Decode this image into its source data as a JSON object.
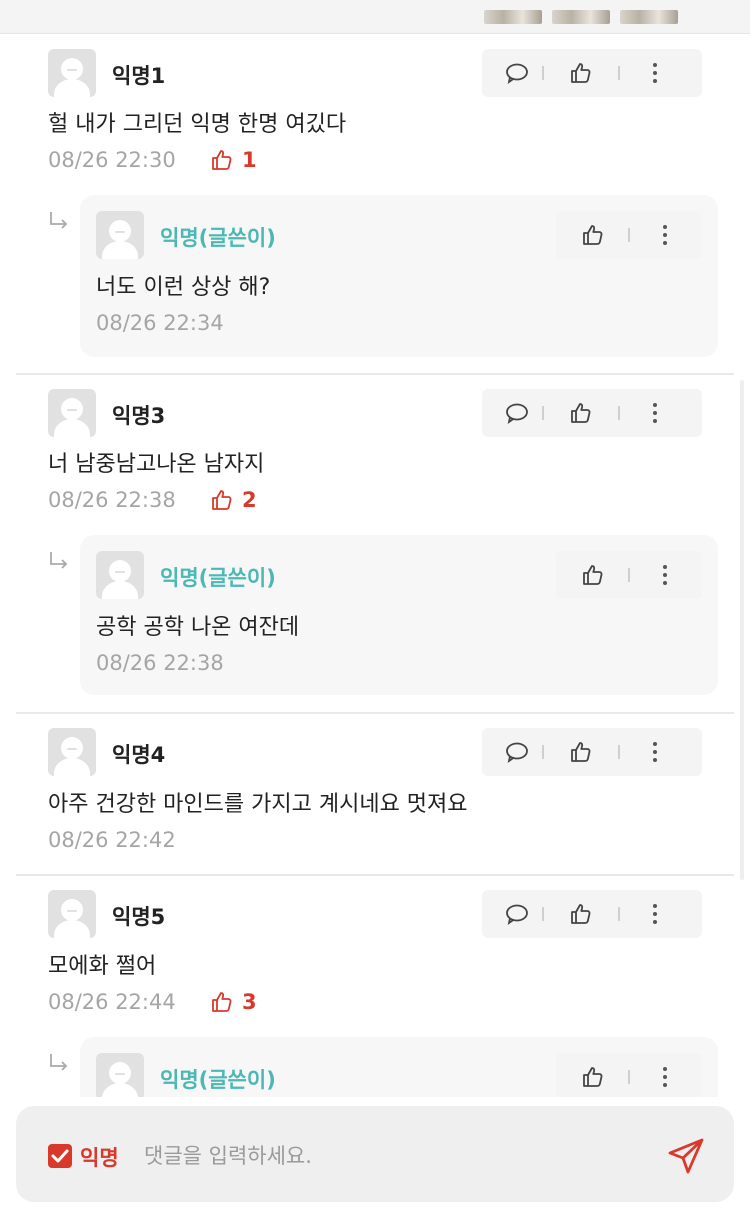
{
  "colors": {
    "accent": "#d8392b",
    "writer": "#4bb8b4",
    "muted": "#a5a5a5"
  },
  "icons": {
    "comment": "comment-icon",
    "like": "thumbs-up-icon",
    "more": "more-vertical-icon",
    "reply": "reply-arrow-icon",
    "send": "send-icon"
  },
  "comments": [
    {
      "author": "익명1",
      "text": "헐 내가 그리던 익명 한명 여깄다",
      "time": "08/26 22:30",
      "likes": "1",
      "reply": {
        "author": "익명(글쓴이)",
        "text": "너도 이런 상상 해?",
        "time": "08/26 22:34"
      }
    },
    {
      "author": "익명3",
      "text": "너 남중남고나온 남자지",
      "time": "08/26 22:38",
      "likes": "2",
      "reply": {
        "author": "익명(글쓴이)",
        "text": "공학 공학 나온 여잔데",
        "time": "08/26 22:38"
      }
    },
    {
      "author": "익명4",
      "text": "아주 건강한 마인드를 가지고 계시네요 멋져요",
      "time": "08/26 22:42"
    },
    {
      "author": "익명5",
      "text": "모에화 쩔어",
      "time": "08/26 22:44",
      "likes": "3",
      "reply": {
        "author": "익명(글쓴이)"
      }
    }
  ],
  "composer": {
    "anonymous_label": "익명",
    "anonymous_checked": true,
    "placeholder": "댓글을 입력하세요."
  }
}
